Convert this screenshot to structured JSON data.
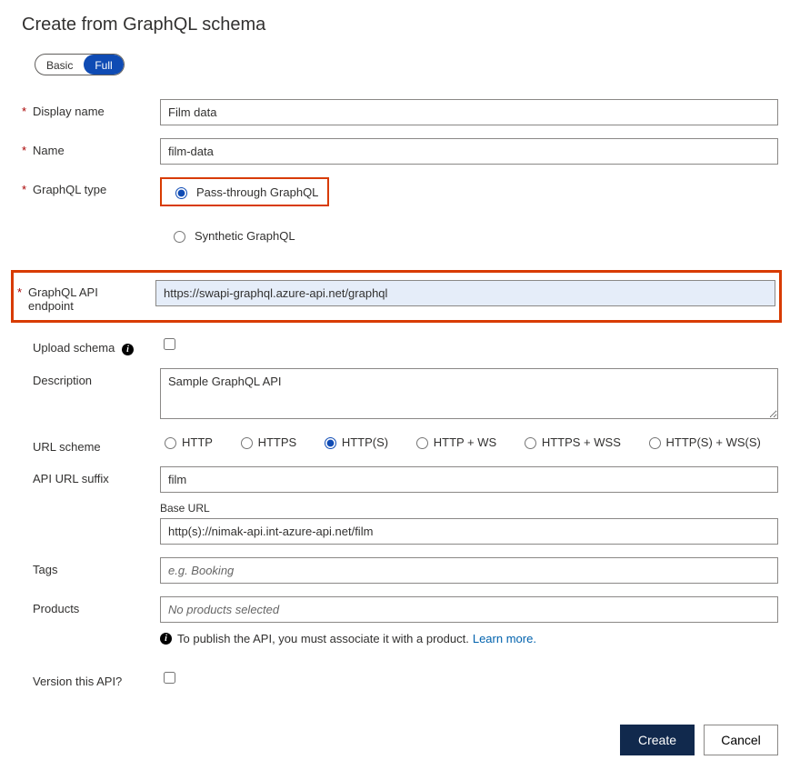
{
  "title": "Create from GraphQL schema",
  "mode": {
    "basic": "Basic",
    "full": "Full"
  },
  "labels": {
    "display_name": "Display name",
    "name": "Name",
    "graphql_type": "GraphQL type",
    "graphql_endpoint_1": "GraphQL API",
    "graphql_endpoint_2": "endpoint",
    "upload_schema": "Upload schema",
    "description": "Description",
    "url_scheme": "URL scheme",
    "api_url_suffix": "API URL suffix",
    "base_url": "Base URL",
    "tags": "Tags",
    "products": "Products",
    "version": "Version this API?"
  },
  "values": {
    "display_name": "Film data",
    "name": "film-data",
    "endpoint": "https://swapi-graphql.azure-api.net/graphql",
    "description": "Sample GraphQL API",
    "api_url_suffix": "film",
    "base_url": "http(s)://nimak-api.int-azure-api.net/film"
  },
  "graphql_types": {
    "passthrough": "Pass-through GraphQL",
    "synthetic": "Synthetic GraphQL"
  },
  "url_schemes": [
    "HTTP",
    "HTTPS",
    "HTTP(S)",
    "HTTP + WS",
    "HTTPS + WSS",
    "HTTP(S) + WS(S)"
  ],
  "placeholders": {
    "tags": "e.g. Booking",
    "products": "No products selected"
  },
  "publish_hint": "To publish the API, you must associate it with a product.",
  "learn_more": "Learn more",
  "buttons": {
    "create": "Create",
    "cancel": "Cancel"
  }
}
